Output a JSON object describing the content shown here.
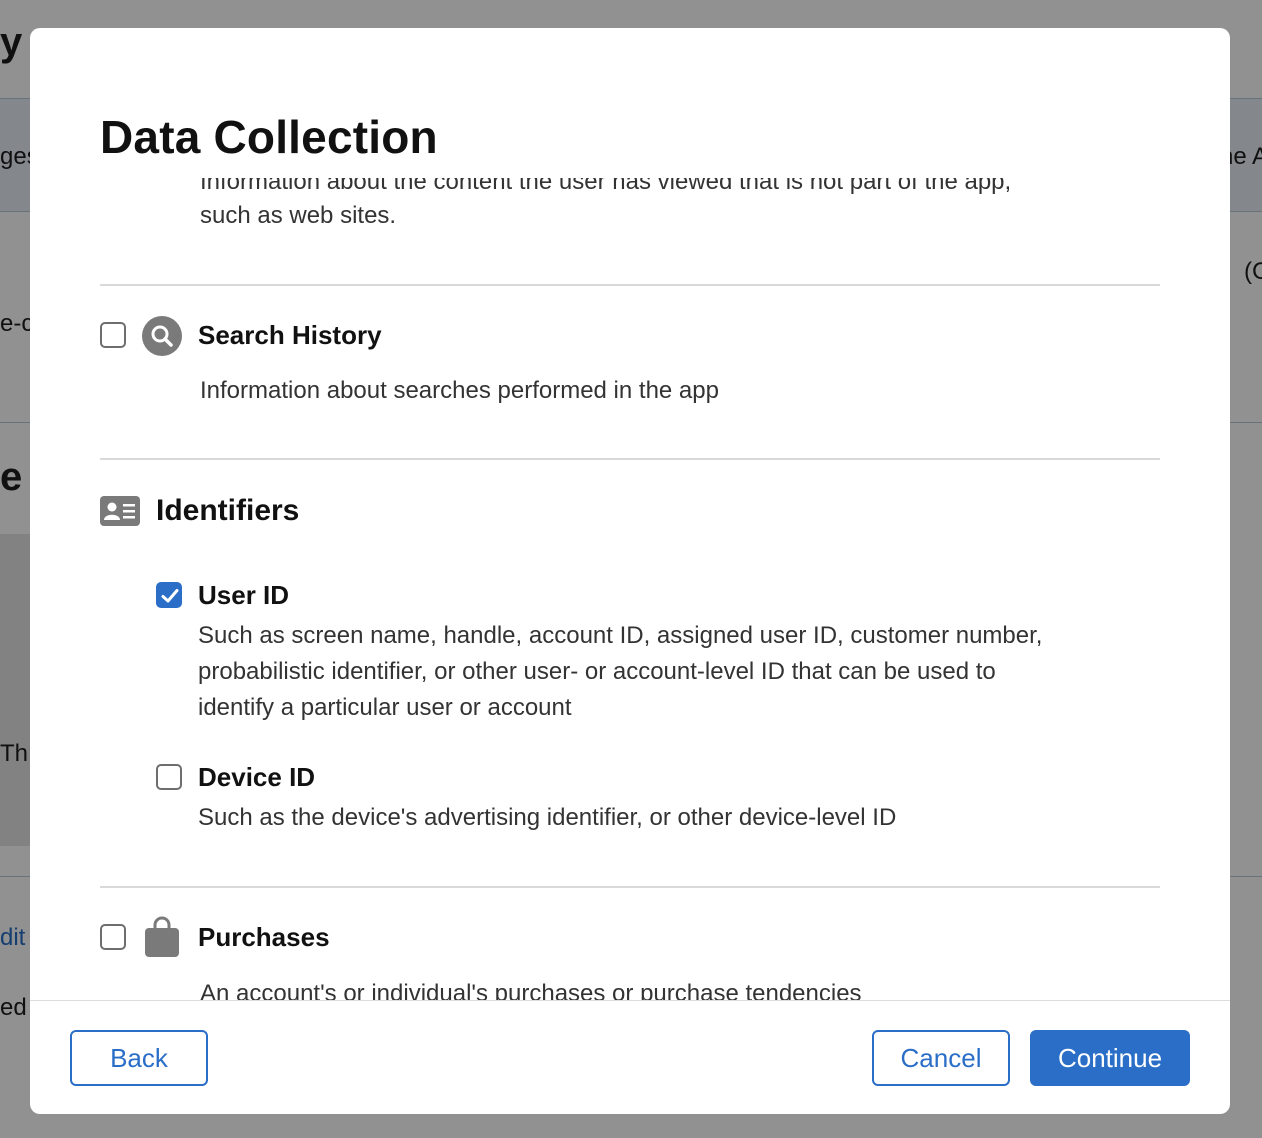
{
  "background": {
    "title_fragment": "y",
    "tab_left_fragment": "ges",
    "tab_right_fragment": "he A",
    "row_left_fragment": "e-c",
    "row_right_fragment": "(C",
    "heading_fragment": "e F",
    "block_text_fragment": "Th",
    "link_fragment": "dit",
    "bottom_fragment": "ed"
  },
  "modal": {
    "title": "Data Collection",
    "partial_top_line": "Information about the content the user has viewed that is not part of the app,",
    "partial_top_line_2": "such as web sites.",
    "items": {
      "search_history": {
        "label": "Search History",
        "description": "Information about searches performed in the app",
        "checked": false,
        "icon": "search-icon"
      },
      "identifiers": {
        "label": "Identifiers",
        "icon": "contact-card-icon",
        "user_id": {
          "label": "User ID",
          "checked": true,
          "description_lines": [
            "Such as screen name, handle, account ID, assigned user ID, customer number,",
            "probabilistic identifier, or other user- or account-level ID that can be used to",
            "identify a particular user or account"
          ]
        },
        "device_id": {
          "label": "Device ID",
          "checked": false,
          "description": "Such as the device's advertising identifier, or other device-level ID"
        }
      },
      "purchases": {
        "label": "Purchases",
        "checked": false,
        "icon": "shopping-bag-icon",
        "description": "An account's or individual's purchases or purchase tendencies"
      }
    },
    "buttons": {
      "back": "Back",
      "cancel": "Cancel",
      "continue": "Continue"
    }
  },
  "colors": {
    "accent": "#2a6ec7",
    "icon_gray": "#7a7a7a"
  }
}
